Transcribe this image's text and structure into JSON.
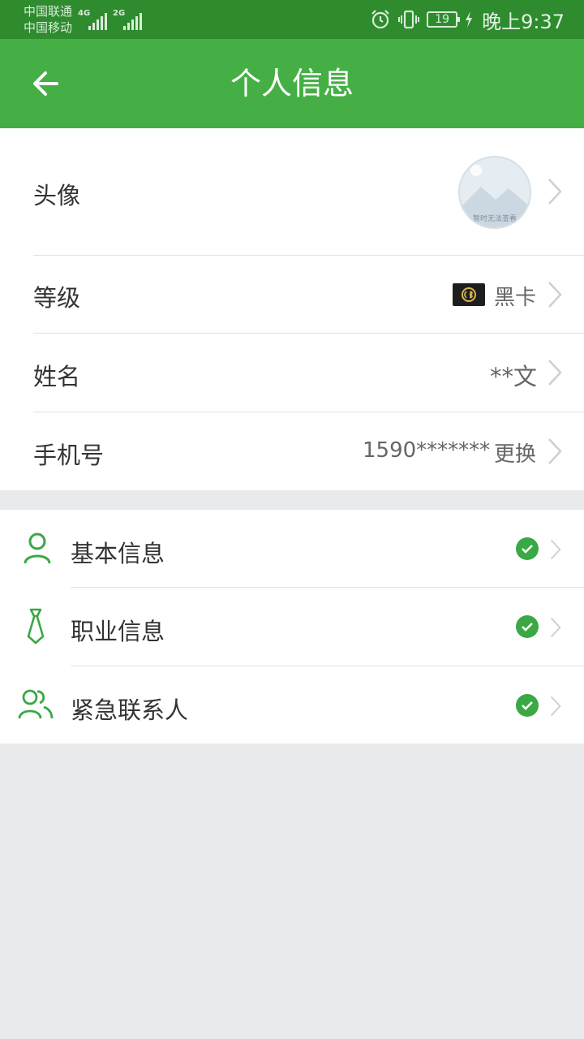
{
  "status_bar": {
    "carrier_1": "中国联通",
    "carrier_2": "中国移动",
    "network_1": "4G",
    "network_2": "2G",
    "battery": "19",
    "time": "晚上9:37"
  },
  "header": {
    "title": "个人信息",
    "back_icon": "arrow-left-icon"
  },
  "profile": {
    "avatar_label": "头像",
    "avatar_placeholder": "暂时无法查看",
    "level_label": "等级",
    "level_value": "黑卡",
    "name_label": "姓名",
    "name_value": "**文",
    "phone_label": "手机号",
    "phone_value": "1590*******",
    "phone_action": "更换"
  },
  "sections": [
    {
      "label": "基本信息",
      "icon": "user-icon",
      "status_icon": "check-circle-icon"
    },
    {
      "label": "职业信息",
      "icon": "tie-icon",
      "status_icon": "check-circle-icon"
    },
    {
      "label": "紧急联系人",
      "icon": "contacts-icon",
      "status_icon": "check-circle-icon"
    }
  ],
  "colors": {
    "status_bar": "#2e8b2e",
    "app_bar": "#45af45",
    "accent": "#3aa844",
    "background": "#e9eaec"
  }
}
